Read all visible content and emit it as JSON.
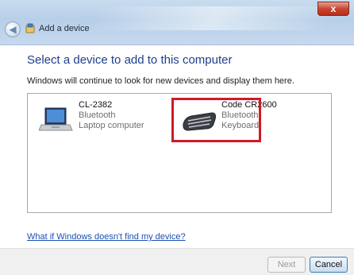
{
  "window": {
    "title": "Add a device",
    "close_label": "x"
  },
  "main": {
    "heading": "Select a device to add to this computer",
    "subtitle": "Windows will continue to look for new devices and display them here.",
    "help_link": "What if Windows doesn't find my device?"
  },
  "devices": [
    {
      "name": "CL-2382",
      "connection": "Bluetooth",
      "type": "Laptop computer",
      "icon": "laptop-icon"
    },
    {
      "name": "Code CR2600",
      "connection": "Bluetooth",
      "type": "Keyboard",
      "icon": "keyboard-icon",
      "highlighted": true
    }
  ],
  "buttons": {
    "next": "Next",
    "cancel": "Cancel"
  },
  "colors": {
    "heading": "#1e3f8a",
    "link": "#1a4fb3",
    "highlight": "#d11a26"
  }
}
